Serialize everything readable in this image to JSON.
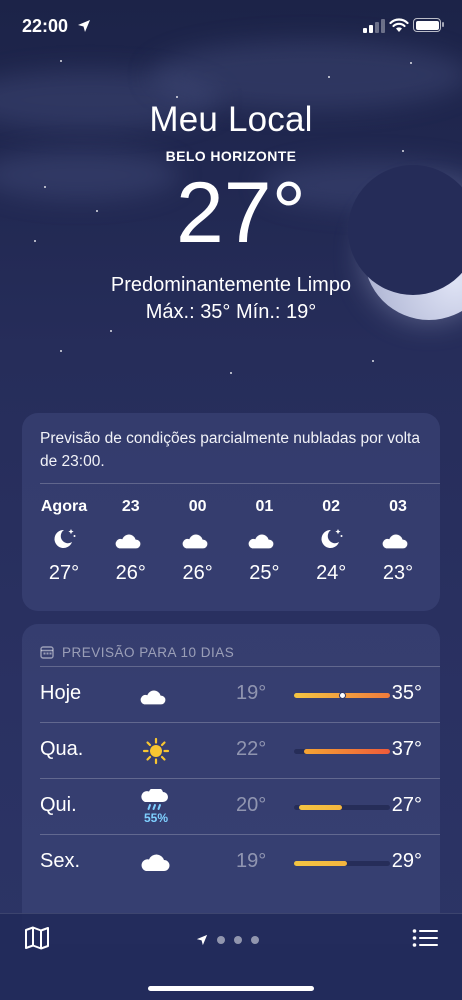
{
  "status_bar": {
    "time": "22:00"
  },
  "header": {
    "location_title": "Meu Local",
    "city": "BELO HORIZONTE",
    "temperature": "27°",
    "condition": "Predominantemente Limpo",
    "high_low": "Máx.: 35°  Mín.: 19°"
  },
  "hourly": {
    "summary": "Previsão de condições parcialmente nubladas por volta de 23:00.",
    "items": [
      {
        "label": "Agora",
        "icon": "moon-stars-icon",
        "temp": "27°"
      },
      {
        "label": "23",
        "icon": "cloud-moon-icon",
        "temp": "26°"
      },
      {
        "label": "00",
        "icon": "cloud-moon-icon",
        "temp": "26°"
      },
      {
        "label": "01",
        "icon": "cloud-moon-icon",
        "temp": "25°"
      },
      {
        "label": "02",
        "icon": "moon-stars-icon",
        "temp": "24°"
      },
      {
        "label": "03",
        "icon": "cloud-moon-icon",
        "temp": "23°"
      }
    ]
  },
  "daily": {
    "title": "PREVISÃO PARA 10 DIAS",
    "days": [
      {
        "name": "Hoje",
        "icon": "cloud-moon-icon",
        "low": "19°",
        "high": "35°",
        "range_start": 0.0,
        "range_end": 1.0,
        "current": 0.5,
        "colors": [
          "#f4c542",
          "#f07b3c"
        ]
      },
      {
        "name": "Qua.",
        "icon": "sun-icon",
        "low": "22°",
        "high": "37°",
        "range_start": 0.1,
        "range_end": 1.0,
        "colors": [
          "#f5a533",
          "#ef5a3a"
        ]
      },
      {
        "name": "Qui.",
        "icon": "cloud-rain-icon",
        "precip": "55%",
        "low": "20°",
        "high": "27°",
        "range_start": 0.05,
        "range_end": 0.5,
        "colors": [
          "#f4c542",
          "#f4b53e"
        ]
      },
      {
        "name": "Sex.",
        "icon": "cloud-icon",
        "low": "19°",
        "high": "29°",
        "range_start": 0.0,
        "range_end": 0.55,
        "colors": [
          "#f4c542",
          "#f4b53e"
        ]
      }
    ]
  },
  "bottom_bar": {
    "map": "map-icon",
    "list": "list-icon"
  }
}
